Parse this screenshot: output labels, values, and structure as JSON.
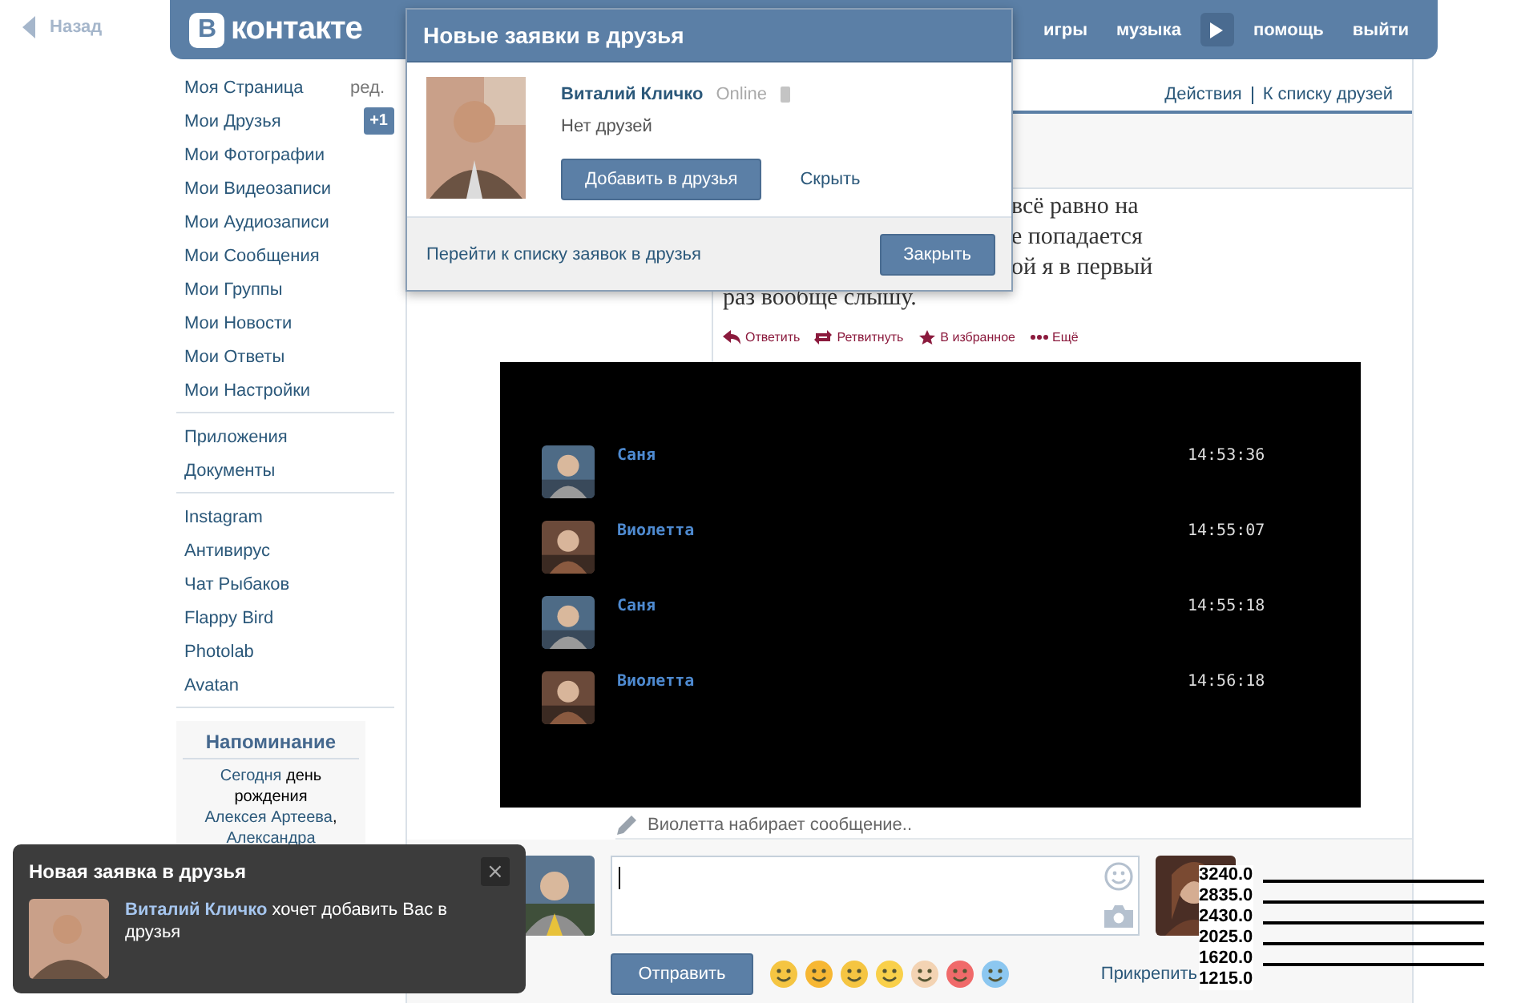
{
  "back_link": "Назад",
  "logo": {
    "mark": "В",
    "text": "контакте"
  },
  "top_nav": [
    {
      "label": "игры",
      "kind": "link"
    },
    {
      "label": "музыка",
      "kind": "link"
    },
    {
      "kind": "play"
    },
    {
      "label": "помощь",
      "kind": "link"
    },
    {
      "label": "выйти",
      "kind": "link"
    }
  ],
  "sidebar": {
    "edit_label": "ред.",
    "friends_badge": "+1",
    "groups": [
      [
        "Моя Страница",
        "Мои Друзья",
        "Мои Фотографии",
        "Мои Видеозаписи",
        "Мои Аудиозаписи",
        "Мои Сообщения",
        "Мои Группы",
        "Мои Новости",
        "Мои Ответы",
        "Мои Настройки"
      ],
      [
        "Приложения",
        "Документы"
      ],
      [
        "Instagram",
        "Антивирус",
        "Чат Рыбаков",
        "Flappy Bird",
        "Photolab",
        "Avatan"
      ]
    ],
    "reminder": {
      "title": "Напоминание",
      "segments": [
        {
          "text": "Сегодня",
          "kind": "link"
        },
        {
          "text": " день рождения ",
          "kind": "plain"
        },
        {
          "text": "Алексея Артеева",
          "kind": "link"
        },
        {
          "text": ", ",
          "kind": "plain"
        },
        {
          "text": "Александра",
          "kind": "link"
        }
      ]
    }
  },
  "header_links": [
    "Действия",
    "К списку друзей"
  ],
  "post": {
    "lines": [
      "всё равно на",
      "е попадается",
      "ой я в первый",
      "раз вообще слышу."
    ],
    "actions": [
      {
        "label": "Ответить",
        "kind": "reply"
      },
      {
        "label": "Ретвитнуть",
        "kind": "retweet"
      },
      {
        "label": "В избранное",
        "kind": "favorite"
      },
      {
        "label": "Ещё",
        "kind": "more"
      }
    ]
  },
  "chat": [
    {
      "name": "Саня",
      "time": "14:53:36",
      "kind": "boy"
    },
    {
      "name": "Виолетта",
      "time": "14:55:07",
      "kind": "girl"
    },
    {
      "name": "Саня",
      "time": "14:55:18",
      "kind": "boy"
    },
    {
      "name": "Виолетта",
      "time": "14:56:18",
      "kind": "girl"
    }
  ],
  "typing": "Виолетта набирает сообщение..",
  "composer": {
    "send": "Отправить",
    "attach": "Прикрепить"
  },
  "overlay_labels": [
    "3240.0",
    "2835.0",
    "2430.0",
    "2025.0",
    "1620.0",
    "1215.0"
  ],
  "popup": {
    "title": "Новые заявки в друзья",
    "name": "Виталий Кличко",
    "status": "Online",
    "subtitle": "Нет друзей",
    "add": "Добавить в друзья",
    "hide": "Скрыть",
    "list_link": "Перейти к списку заявок в друзья",
    "close": "Закрыть"
  },
  "toast": {
    "title": "Новая заявка в друзья",
    "close": "×",
    "name": "Виталий Кличко",
    "text": "хочет добавить Вас в друзья"
  }
}
